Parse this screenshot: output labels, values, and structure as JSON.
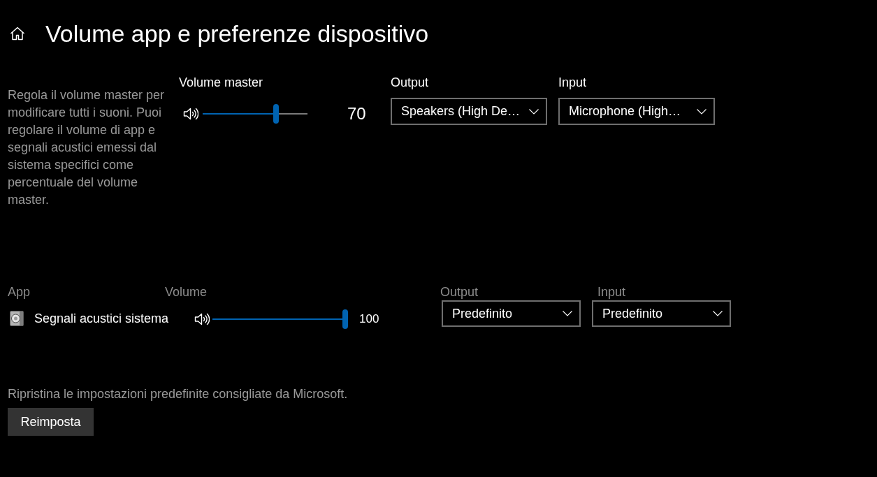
{
  "header": {
    "title": "Volume app e preferenze dispositivo"
  },
  "master": {
    "description": "Regola il volume master per modificare tutti i suoni. Puoi regolare il volume di app e segnali acustici emessi dal sistema specifici come percentuale del volume master.",
    "label": "Volume master",
    "level": 0.7,
    "reading": "70",
    "output": {
      "label": "Output",
      "value": "Speakers (High De…"
    },
    "input": {
      "label": "Input",
      "value": "Microphone (High…"
    }
  },
  "apps_table": {
    "columns": [
      "App",
      "Volume",
      "Output",
      "Input"
    ],
    "rows": [
      {
        "name": "Segnali acustici sistema",
        "level": 1.0,
        "reading": "100",
        "output": "Predefinito",
        "input": "Predefinito"
      }
    ]
  },
  "reset": {
    "description": "Ripristina le impostazioni predefinite consigliate da Microsoft.",
    "button": "Reimposta"
  }
}
